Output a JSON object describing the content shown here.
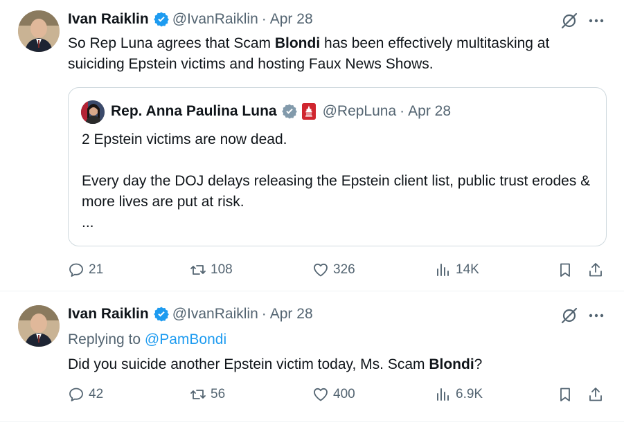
{
  "tweets": [
    {
      "author": {
        "name": "Ivan Raiklin",
        "handle": "@IvanRaiklin"
      },
      "separator": "·",
      "date": "Apr 28",
      "text_segments": [
        "So Rep Luna agrees that Scam ",
        "Blondi",
        " has been effectively multitasking at suiciding Epstein victims and hosting Faux News Shows."
      ],
      "quote": {
        "author": {
          "name": "Rep. Anna Paulina Luna",
          "handle": "@RepLuna"
        },
        "separator": "·",
        "date": "Apr 28",
        "paragraphs": [
          "2 Epstein victims are now dead.",
          "Every day the DOJ delays releasing the Epstein client list, public trust erodes & more lives are put at risk."
        ],
        "ellipsis": "..."
      },
      "stats": {
        "replies": "21",
        "reposts": "108",
        "likes": "326",
        "views": "14K"
      }
    },
    {
      "author": {
        "name": "Ivan Raiklin",
        "handle": "@IvanRaiklin"
      },
      "separator": "·",
      "date": "Apr 28",
      "replying_label": "Replying to ",
      "replying_to": "@PamBondi",
      "text_segments": [
        "Did you suicide another Epstein victim today, Ms. Scam ",
        "Blondi",
        "?"
      ],
      "stats": {
        "replies": "42",
        "reposts": "56",
        "likes": "400",
        "views": "6.9K"
      }
    }
  ],
  "icons": {
    "verified": "verified-badge-icon",
    "grok": "grok-icon",
    "more": "more-dots-icon",
    "reply": "reply-icon",
    "repost": "repost-icon",
    "like": "heart-icon",
    "views": "views-icon",
    "bookmark": "bookmark-icon",
    "share": "share-icon",
    "congress": "congress-flag-icon"
  },
  "colors": {
    "text": "#0f1419",
    "muted": "#536471",
    "accent": "#1d9bf0",
    "border": "#cfd9de",
    "congress_red": "#d0262f"
  }
}
